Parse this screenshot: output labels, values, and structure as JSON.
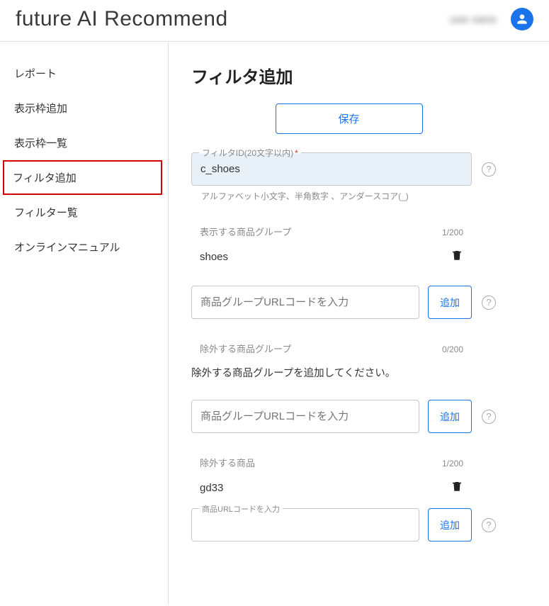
{
  "header": {
    "logo": "future AI Recommend",
    "user_text": "user name"
  },
  "sidebar": {
    "items": [
      {
        "label": "レポート"
      },
      {
        "label": "表示枠追加"
      },
      {
        "label": "表示枠一覧"
      },
      {
        "label": "フィルタ追加"
      },
      {
        "label": "フィルター覧"
      },
      {
        "label": "オンラインマニュアル"
      }
    ]
  },
  "main": {
    "title": "フィルタ追加",
    "save_label": "保存",
    "filter_id": {
      "label": "フィルタID(20文字以内)",
      "required_mark": "*",
      "value": "c_shoes",
      "helper": "アルファベット小文字、半角数字 、アンダースコア(_)"
    },
    "display_group": {
      "label": "表示する商品グループ",
      "count": "1/200",
      "item": "shoes",
      "input_placeholder": "商品グループURLコードを入力",
      "add_label": "追加"
    },
    "exclude_group": {
      "label": "除外する商品グループ",
      "count": "0/200",
      "empty_msg": "除外する商品グループを追加してください。",
      "input_placeholder": "商品グループURLコードを入力",
      "add_label": "追加"
    },
    "exclude_product": {
      "label": "除外する商品",
      "count": "1/200",
      "item": "gd33",
      "input_legend": "商品URLコードを入力",
      "add_label": "追加"
    },
    "help_glyph": "?"
  }
}
